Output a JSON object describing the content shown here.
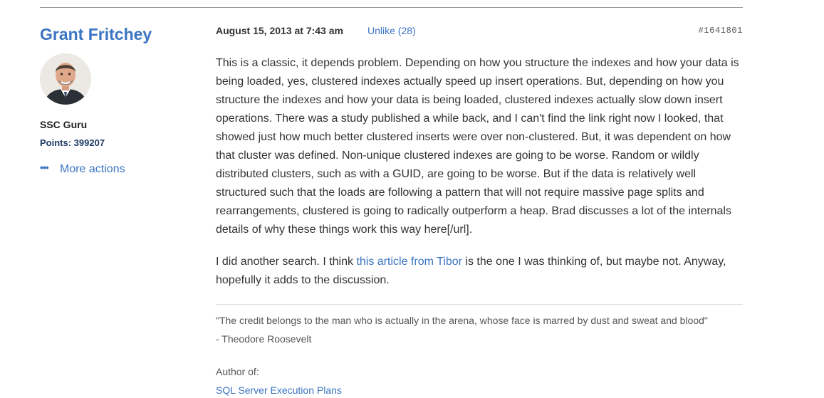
{
  "author": {
    "name": "Grant Fritchey",
    "rank": "SSC Guru",
    "points": "Points: 399207",
    "more_actions": "More actions"
  },
  "post": {
    "date": "August 15, 2013 at 7:43 am",
    "unlike": "Unlike (28)",
    "id": "#1641801",
    "paragraph1": "This is a classic, it depends problem. Depending on how you structure the indexes and how your data is being loaded, yes, clustered indexes actually speed up insert operations. But, depending on how you structure the indexes and how your data is being loaded, clustered indexes actually slow down insert operations. There was a study published a while back, and I can't find the link right now I looked, that showed just how much better clustered inserts were over non-clustered. But, it was dependent on how that cluster was defined. Non-unique clustered indexes are going to be worse. Random or wildly distributed clusters, such as with a GUID, are going to be worse. But if the data is relatively well structured such that the loads are following a pattern that will not require massive page splits and rearrangements, clustered is going to radically outperform a heap. Brad discusses a lot of the internals details of why these things work this way here[/url].",
    "paragraph2_before": "I did another search. I think ",
    "paragraph2_link": "this article from Tibor",
    "paragraph2_after": " is the one I was thinking of, but maybe not. Anyway, hopefully it adds to the discussion."
  },
  "signature": {
    "quote": "\"The credit belongs to the man who is actually in the arena, whose face is marred by dust and sweat and blood\"",
    "attribution": "- Theodore Roosevelt",
    "author_of": "Author of:",
    "book_link": "SQL Server Execution Plans"
  },
  "colors": {
    "link": "#3a74c2",
    "text": "#333333",
    "muted": "#555555"
  }
}
